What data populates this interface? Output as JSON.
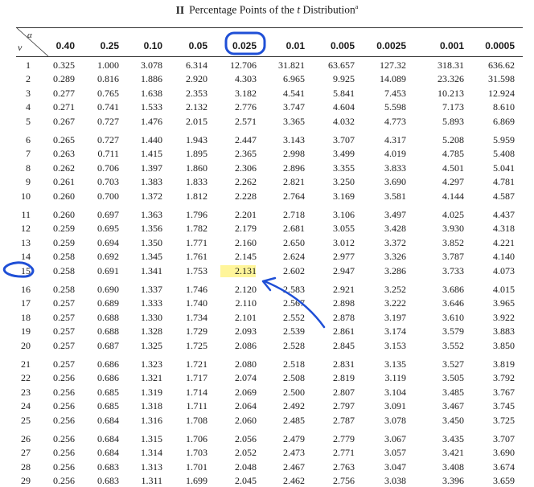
{
  "title": {
    "roman": "II",
    "text_before": "Percentage Points of the ",
    "tvar": "t",
    "text_after": " Distribution",
    "footnote_mark": "a"
  },
  "header": {
    "alpha": "α",
    "nu": "ν",
    "columns": [
      "0.40",
      "0.25",
      "0.10",
      "0.05",
      "0.025",
      "0.01",
      "0.005",
      "0.0025",
      "0.001",
      "0.0005"
    ]
  },
  "rows": [
    {
      "nu": "1",
      "v": [
        "0.325",
        "1.000",
        "3.078",
        "6.314",
        "12.706",
        "31.821",
        "63.657",
        "127.32",
        "318.31",
        "636.62"
      ]
    },
    {
      "nu": "2",
      "v": [
        "0.289",
        "0.816",
        "1.886",
        "2.920",
        "4.303",
        "6.965",
        "9.925",
        "14.089",
        "23.326",
        "31.598"
      ]
    },
    {
      "nu": "3",
      "v": [
        "0.277",
        "0.765",
        "1.638",
        "2.353",
        "3.182",
        "4.541",
        "5.841",
        "7.453",
        "10.213",
        "12.924"
      ]
    },
    {
      "nu": "4",
      "v": [
        "0.271",
        "0.741",
        "1.533",
        "2.132",
        "2.776",
        "3.747",
        "4.604",
        "5.598",
        "7.173",
        "8.610"
      ]
    },
    {
      "nu": "5",
      "v": [
        "0.267",
        "0.727",
        "1.476",
        "2.015",
        "2.571",
        "3.365",
        "4.032",
        "4.773",
        "5.893",
        "6.869"
      ]
    },
    {
      "nu": "6",
      "v": [
        "0.265",
        "0.727",
        "1.440",
        "1.943",
        "2.447",
        "3.143",
        "3.707",
        "4.317",
        "5.208",
        "5.959"
      ]
    },
    {
      "nu": "7",
      "v": [
        "0.263",
        "0.711",
        "1.415",
        "1.895",
        "2.365",
        "2.998",
        "3.499",
        "4.019",
        "4.785",
        "5.408"
      ]
    },
    {
      "nu": "8",
      "v": [
        "0.262",
        "0.706",
        "1.397",
        "1.860",
        "2.306",
        "2.896",
        "3.355",
        "3.833",
        "4.501",
        "5.041"
      ]
    },
    {
      "nu": "9",
      "v": [
        "0.261",
        "0.703",
        "1.383",
        "1.833",
        "2.262",
        "2.821",
        "3.250",
        "3.690",
        "4.297",
        "4.781"
      ]
    },
    {
      "nu": "10",
      "v": [
        "0.260",
        "0.700",
        "1.372",
        "1.812",
        "2.228",
        "2.764",
        "3.169",
        "3.581",
        "4.144",
        "4.587"
      ]
    },
    {
      "nu": "11",
      "v": [
        "0.260",
        "0.697",
        "1.363",
        "1.796",
        "2.201",
        "2.718",
        "3.106",
        "3.497",
        "4.025",
        "4.437"
      ]
    },
    {
      "nu": "12",
      "v": [
        "0.259",
        "0.695",
        "1.356",
        "1.782",
        "2.179",
        "2.681",
        "3.055",
        "3.428",
        "3.930",
        "4.318"
      ]
    },
    {
      "nu": "13",
      "v": [
        "0.259",
        "0.694",
        "1.350",
        "1.771",
        "2.160",
        "2.650",
        "3.012",
        "3.372",
        "3.852",
        "4.221"
      ]
    },
    {
      "nu": "14",
      "v": [
        "0.258",
        "0.692",
        "1.345",
        "1.761",
        "2.145",
        "2.624",
        "2.977",
        "3.326",
        "3.787",
        "4.140"
      ]
    },
    {
      "nu": "15",
      "v": [
        "0.258",
        "0.691",
        "1.341",
        "1.753",
        "2.131",
        "2.602",
        "2.947",
        "3.286",
        "3.733",
        "4.073"
      ]
    },
    {
      "nu": "16",
      "v": [
        "0.258",
        "0.690",
        "1.337",
        "1.746",
        "2.120",
        "2.583",
        "2.921",
        "3.252",
        "3.686",
        "4.015"
      ]
    },
    {
      "nu": "17",
      "v": [
        "0.257",
        "0.689",
        "1.333",
        "1.740",
        "2.110",
        "2.567",
        "2.898",
        "3.222",
        "3.646",
        "3.965"
      ]
    },
    {
      "nu": "18",
      "v": [
        "0.257",
        "0.688",
        "1.330",
        "1.734",
        "2.101",
        "2.552",
        "2.878",
        "3.197",
        "3.610",
        "3.922"
      ]
    },
    {
      "nu": "19",
      "v": [
        "0.257",
        "0.688",
        "1.328",
        "1.729",
        "2.093",
        "2.539",
        "2.861",
        "3.174",
        "3.579",
        "3.883"
      ]
    },
    {
      "nu": "20",
      "v": [
        "0.257",
        "0.687",
        "1.325",
        "1.725",
        "2.086",
        "2.528",
        "2.845",
        "3.153",
        "3.552",
        "3.850"
      ]
    },
    {
      "nu": "21",
      "v": [
        "0.257",
        "0.686",
        "1.323",
        "1.721",
        "2.080",
        "2.518",
        "2.831",
        "3.135",
        "3.527",
        "3.819"
      ]
    },
    {
      "nu": "22",
      "v": [
        "0.256",
        "0.686",
        "1.321",
        "1.717",
        "2.074",
        "2.508",
        "2.819",
        "3.119",
        "3.505",
        "3.792"
      ]
    },
    {
      "nu": "23",
      "v": [
        "0.256",
        "0.685",
        "1.319",
        "1.714",
        "2.069",
        "2.500",
        "2.807",
        "3.104",
        "3.485",
        "3.767"
      ]
    },
    {
      "nu": "24",
      "v": [
        "0.256",
        "0.685",
        "1.318",
        "1.711",
        "2.064",
        "2.492",
        "2.797",
        "3.091",
        "3.467",
        "3.745"
      ]
    },
    {
      "nu": "25",
      "v": [
        "0.256",
        "0.684",
        "1.316",
        "1.708",
        "2.060",
        "2.485",
        "2.787",
        "3.078",
        "3.450",
        "3.725"
      ]
    },
    {
      "nu": "26",
      "v": [
        "0.256",
        "0.684",
        "1.315",
        "1.706",
        "2.056",
        "2.479",
        "2.779",
        "3.067",
        "3.435",
        "3.707"
      ]
    },
    {
      "nu": "27",
      "v": [
        "0.256",
        "0.684",
        "1.314",
        "1.703",
        "2.052",
        "2.473",
        "2.771",
        "3.057",
        "3.421",
        "3.690"
      ]
    },
    {
      "nu": "28",
      "v": [
        "0.256",
        "0.683",
        "1.313",
        "1.701",
        "2.048",
        "2.467",
        "2.763",
        "3.047",
        "3.408",
        "3.674"
      ]
    },
    {
      "nu": "29",
      "v": [
        "0.256",
        "0.683",
        "1.311",
        "1.699",
        "2.045",
        "2.462",
        "2.756",
        "3.038",
        "3.396",
        "3.659"
      ]
    }
  ],
  "highlight": {
    "row_nu": "15",
    "column": "0.025",
    "value": "2.131",
    "color": "#fff59a"
  },
  "annotations": {
    "ink_color": "#1f4fd6"
  }
}
